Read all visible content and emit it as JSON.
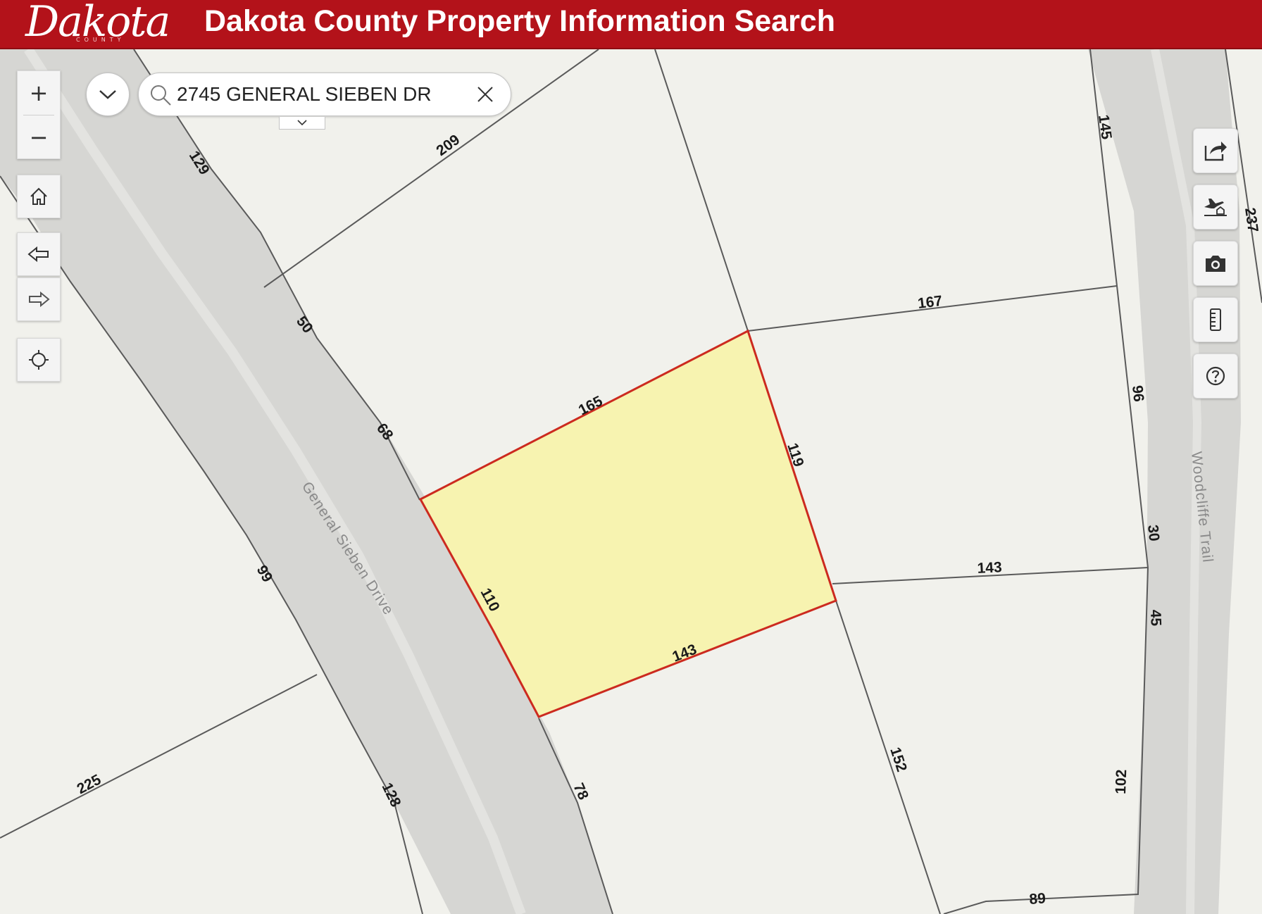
{
  "header": {
    "logo_text": "Dakota",
    "logo_subtext": "COUNTY",
    "title": "Dakota County Property Information Search"
  },
  "search": {
    "value": "2745 GENERAL SIEBEN DR"
  },
  "map": {
    "street_labels": [
      "General Sieben Drive",
      "Woodcliffe Trail"
    ],
    "selected_parcel": {
      "fill": "#f7f3b0",
      "stroke": "#cc2a1f",
      "dimensions": [
        "165",
        "119",
        "110",
        "143"
      ]
    },
    "parcel_dimensions": [
      "129",
      "209",
      "50",
      "68",
      "167",
      "145",
      "237",
      "96",
      "143",
      "30",
      "45",
      "99",
      "225",
      "128",
      "78",
      "152",
      "102",
      "89"
    ]
  },
  "colors": {
    "header_bg": "#b3121a",
    "map_bg": "#f1f1ec",
    "road": "#d6d6d3",
    "parcel_line": "#555555"
  },
  "icons": {
    "zoom_in": "plus-icon",
    "zoom_out": "minus-icon",
    "home": "home-icon",
    "back": "arrow-left-icon",
    "forward": "arrow-right-icon",
    "locate": "crosshair-icon",
    "share": "share-icon",
    "aerial": "plane-home-icon",
    "camera": "camera-icon",
    "measure": "ruler-icon",
    "help": "help-icon"
  }
}
